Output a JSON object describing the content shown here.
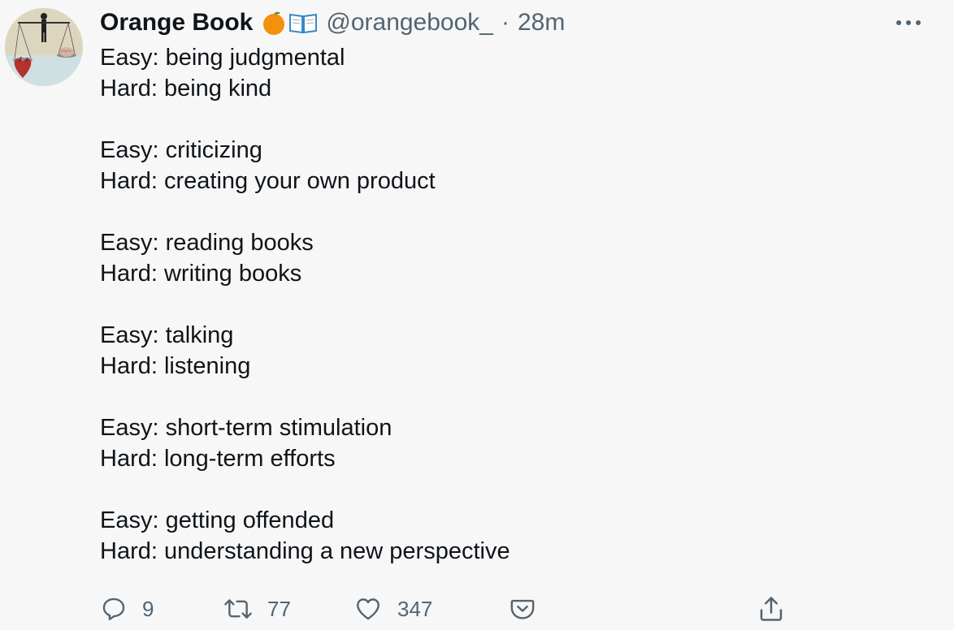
{
  "tweet": {
    "author_name": "Orange Book",
    "author_emojis": [
      "orange-emoji",
      "open-book-emoji"
    ],
    "handle": "@orangebook_",
    "separator": "·",
    "time": "28m",
    "paragraphs": [
      [
        "Easy: being judgmental",
        "Hard: being kind"
      ],
      [
        "Easy: criticizing",
        "Hard: creating your own product"
      ],
      [
        "Easy: reading books",
        "Hard: writing books"
      ],
      [
        "Easy: talking",
        "Hard: listening"
      ],
      [
        "Easy: short-term stimulation",
        "Hard: long-term efforts"
      ],
      [
        "Easy: getting offended",
        "Hard: understanding a new perspective"
      ]
    ]
  },
  "actions": {
    "reply_count": "9",
    "retweet_count": "77",
    "like_count": "347"
  },
  "colors": {
    "background": "#f7f7f7",
    "text": "#0f1419",
    "muted": "#536471",
    "orange": "#f4900c"
  },
  "icons": {
    "more": "more-dots-icon",
    "reply": "reply-bubble-icon",
    "retweet": "retweet-arrows-icon",
    "like": "heart-icon",
    "pocket": "pocket-save-icon",
    "share": "share-upload-icon"
  }
}
